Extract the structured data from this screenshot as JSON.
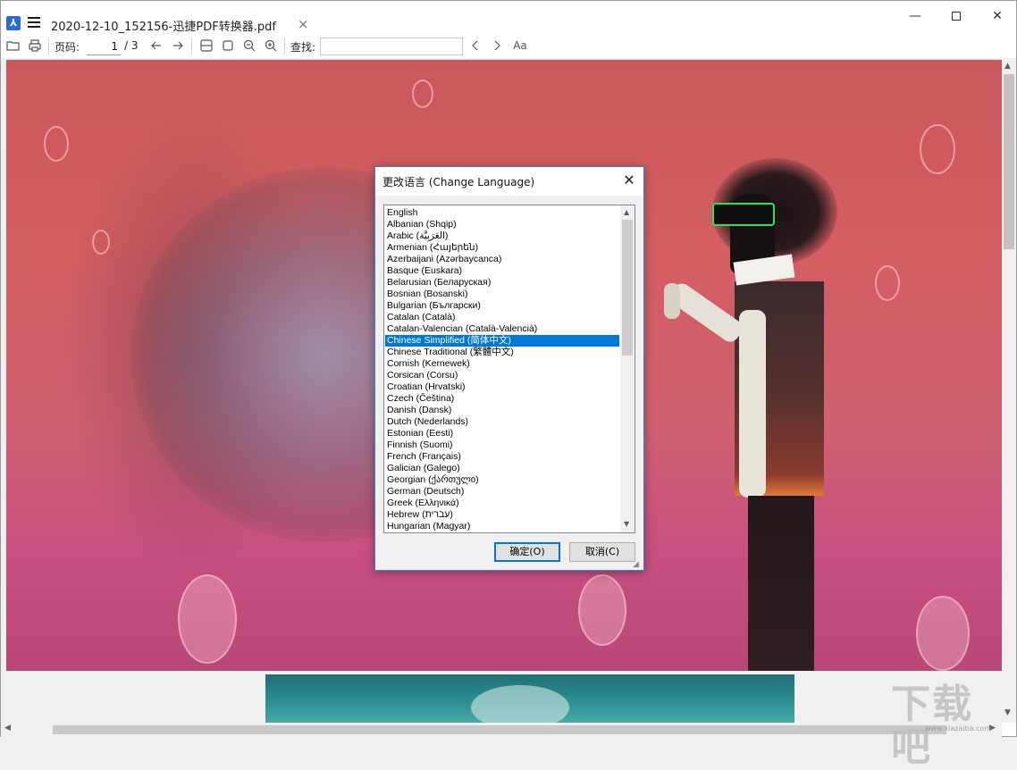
{
  "app": {
    "doc_title": "2020-12-10_152156-迅捷PDF转换器.pdf",
    "tab_close": "×",
    "win_min": "—",
    "win_close": "✕"
  },
  "toolbar": {
    "page_label": "页码:",
    "page_current": "1",
    "page_total": "/ 3",
    "find_label": "查找:",
    "font_icon": "Aa"
  },
  "dialog": {
    "title": "更改语言 (Change Language)",
    "close": "✕",
    "ok_label": "确定(O)",
    "cancel_label": "取消(C)",
    "selected_index": 11,
    "languages": [
      "English",
      "Albanian (Shqip)",
      "Arabic (العَرَبِيَّة)",
      "Armenian (Հայերեն)",
      "Azerbaijani (Azərbaycanca)",
      "Basque (Euskara)",
      "Belarusian (Беларуская)",
      "Bosnian (Bosanski)",
      "Bulgarian (Български)",
      "Catalan (Català)",
      "Catalan-Valencian (Català-Valencià)",
      "Chinese Simplified (简体中文)",
      "Chinese Traditional (繁體中文)",
      "Cornish (Kernewek)",
      "Corsican (Corsu)",
      "Croatian (Hrvatski)",
      "Czech (Čeština)",
      "Danish (Dansk)",
      "Dutch (Nederlands)",
      "Estonian (Eesti)",
      "Finnish (Suomi)",
      "French (Français)",
      "Galician (Galego)",
      "Georgian (ქართული)",
      "German (Deutsch)",
      "Greek (Ελληνικά)",
      "Hebrew (עברית)",
      "Hungarian (Magyar)"
    ]
  },
  "watermark": {
    "text": "下载吧",
    "url": "www.xiazaiba.com"
  }
}
